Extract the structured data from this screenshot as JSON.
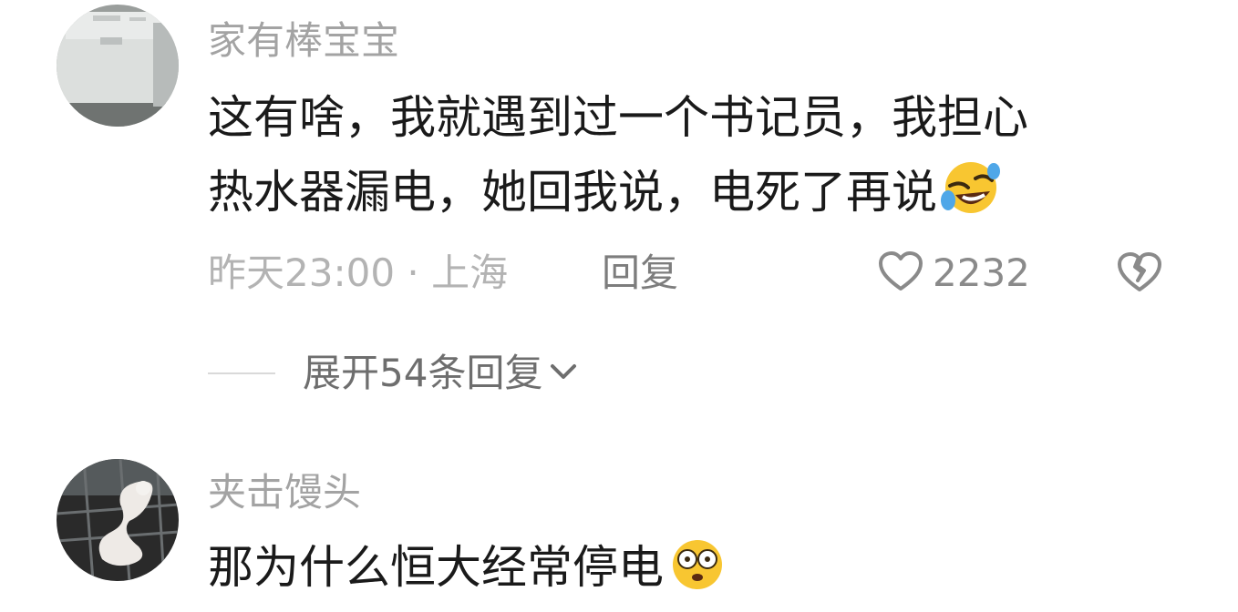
{
  "comments": [
    {
      "username": "家有棒宝宝",
      "content_line1": "这有啥，我就遇到过一个书记员，我担心",
      "content_line2": "热水器漏电，她回我说，电死了再说",
      "content_emoji": "rofl-emoji",
      "time_location": "昨天23:00 · 上海",
      "reply_label": "回复",
      "like_count": "2232",
      "expand_label": "展开54条回复"
    },
    {
      "username": "夹击馒头",
      "content_line1": "那为什么恒大经常停电",
      "content_emoji": "dazed-emoji"
    }
  ],
  "icons": {
    "like": "heart-icon",
    "dislike": "broken-heart-icon",
    "expand": "chevron-down-icon"
  },
  "colors": {
    "username": "#a3a3a3",
    "content": "#1a1a1a",
    "meta": "#b3b3b3",
    "reply": "#7d7d7d",
    "emoji_yellow": "#f8c631"
  }
}
